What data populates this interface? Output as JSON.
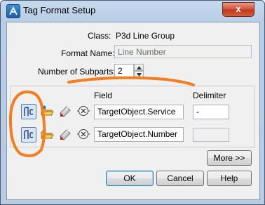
{
  "window": {
    "title": "Tag Format Setup",
    "close_label": "x"
  },
  "form": {
    "class_label": "Class:",
    "class_value": "P3d Line Group",
    "format_name_label": "Format Name:",
    "format_name_value": "Line Number",
    "subparts_label": "Number of Subparts:",
    "subparts_value": "2"
  },
  "grid": {
    "field_header": "Field",
    "delimiter_header": "Delimiter",
    "rows": [
      {
        "field": "TargetObject.Service",
        "delimiter": "-"
      },
      {
        "field": "TargetObject.Number",
        "delimiter": ""
      }
    ]
  },
  "buttons": {
    "more": "More >>",
    "ok": "OK",
    "cancel": "Cancel",
    "help": "Help"
  },
  "colors": {
    "annotation": "#f47d20",
    "titlebar": "#c6d9ee",
    "close": "#c9432a"
  }
}
